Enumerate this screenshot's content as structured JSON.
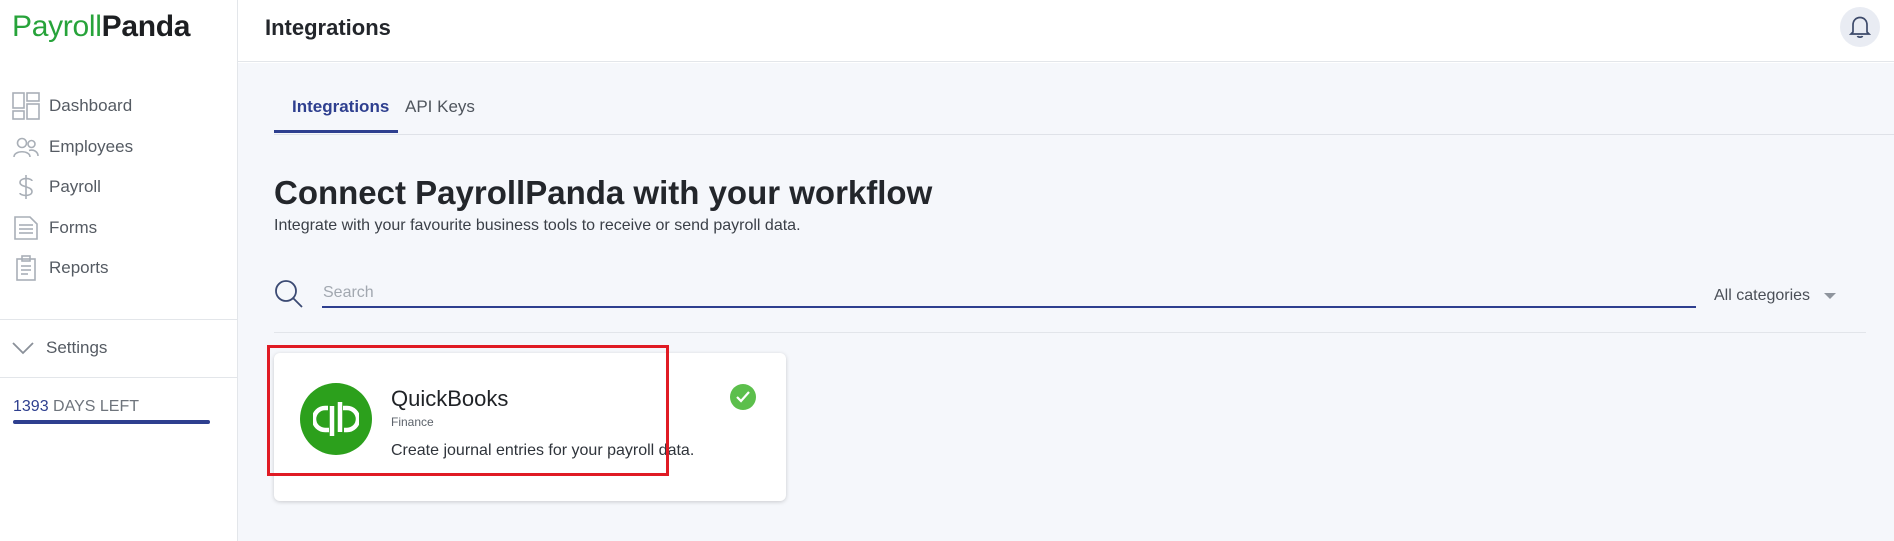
{
  "app": {
    "logo_part1": "Payroll",
    "logo_part2": "Panda"
  },
  "sidebar": {
    "items": [
      {
        "label": "Dashboard",
        "icon": "dashboard-icon"
      },
      {
        "label": "Employees",
        "icon": "employees-icon"
      },
      {
        "label": "Payroll",
        "icon": "dollar-icon"
      },
      {
        "label": "Forms",
        "icon": "forms-icon"
      },
      {
        "label": "Reports",
        "icon": "clipboard-icon"
      }
    ],
    "settings_label": "Settings",
    "days_left_count": "1393",
    "days_left_label": "DAYS LEFT",
    "days_left_progress": 1.0
  },
  "header": {
    "title": "Integrations"
  },
  "tabs": [
    {
      "label": "Integrations",
      "active": true
    },
    {
      "label": "API Keys",
      "active": false
    }
  ],
  "main": {
    "heading": "Connect PayrollPanda with your workflow",
    "subheading": "Integrate with your favourite business tools to receive or send payroll data.",
    "search_placeholder": "Search",
    "search_value": "",
    "category_selected": "All categories"
  },
  "integrations": [
    {
      "name": "QuickBooks",
      "category": "Finance",
      "description": "Create journal entries for your payroll data.",
      "connected": true,
      "logo_color": "#2ca01c"
    }
  ],
  "colors": {
    "brand_green": "#27a33a",
    "accent_blue": "#2e3f8f",
    "highlight_red": "#e01b24",
    "check_green": "#5cbf4c"
  }
}
